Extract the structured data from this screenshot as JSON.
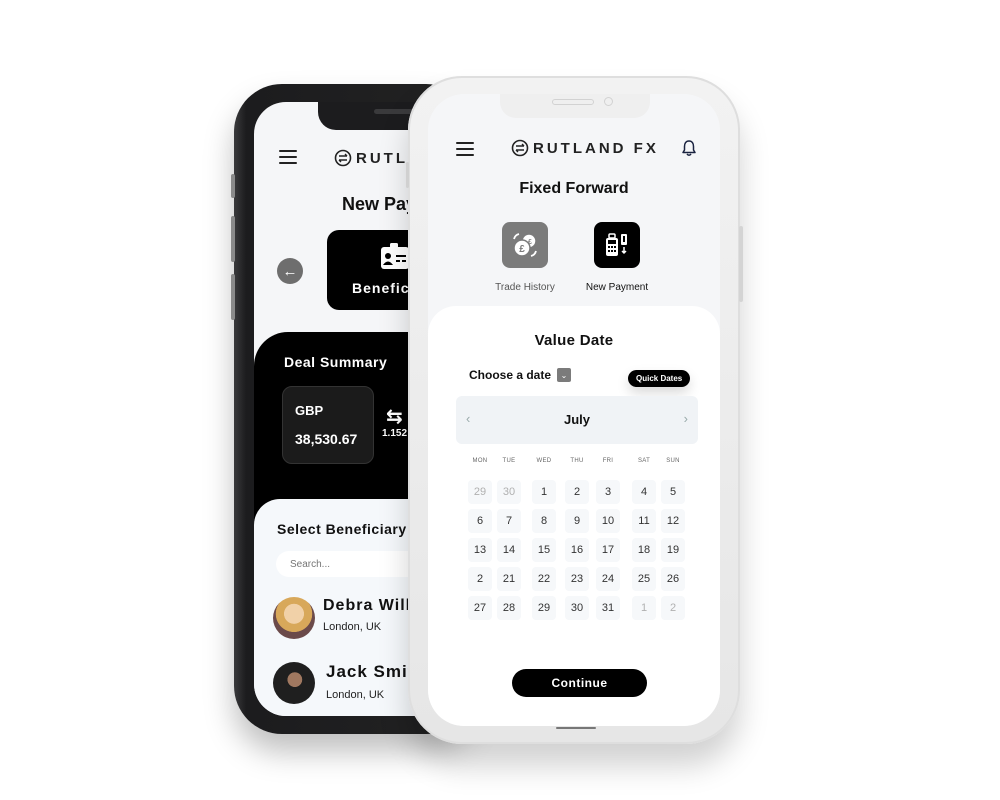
{
  "back_phone": {
    "brand": "RUTLAND FX",
    "page_title": "New Payment",
    "back_icon": "arrow-left-icon",
    "beneficiary_card": {
      "icon": "id-card-icon",
      "label": "Beneficiary"
    },
    "deal_summary": {
      "title": "Deal Summary",
      "currency": "GBP",
      "amount": "38,530.67",
      "swap_icon": "swap-arrows-icon",
      "rate": "1.152"
    },
    "select_beneficiary": {
      "title": "Select Beneficiary",
      "search_placeholder": "Search...",
      "items": [
        {
          "name": "Debra Williams",
          "location": "London, UK",
          "avatar_color": "#c9a06a"
        },
        {
          "name": "Jack Smith",
          "location": "London, UK",
          "avatar_color": "#2a2a2a"
        }
      ]
    }
  },
  "front_phone": {
    "brand": "RUTLAND FX",
    "menu_icon": "hamburger-icon",
    "bell_icon": "bell-icon",
    "page_title": "Fixed Forward",
    "tiles": [
      {
        "label": "Trade History",
        "icon": "coins-exchange-icon"
      },
      {
        "label": "New Payment",
        "icon": "card-terminal-icon"
      }
    ],
    "value_date": {
      "title": "Value Date",
      "choose_label": "Choose a date",
      "quick_dates_label": "Quick Dates",
      "month": "July",
      "weekdays": [
        "MON",
        "TUE",
        "WED",
        "THU",
        "FRI",
        "SAT",
        "SUN"
      ],
      "weeks": [
        [
          {
            "d": "29",
            "muted": true
          },
          {
            "d": "30",
            "muted": true
          },
          {
            "d": "1"
          },
          {
            "d": "2"
          },
          {
            "d": "3"
          },
          {
            "d": "4"
          },
          {
            "d": "5"
          }
        ],
        [
          {
            "d": "6"
          },
          {
            "d": "7"
          },
          {
            "d": "8"
          },
          {
            "d": "9"
          },
          {
            "d": "10"
          },
          {
            "d": "11"
          },
          {
            "d": "12"
          }
        ],
        [
          {
            "d": "13"
          },
          {
            "d": "14"
          },
          {
            "d": "15"
          },
          {
            "d": "16"
          },
          {
            "d": "17"
          },
          {
            "d": "18"
          },
          {
            "d": "19"
          }
        ],
        [
          {
            "d": "2"
          },
          {
            "d": "21"
          },
          {
            "d": "22"
          },
          {
            "d": "23"
          },
          {
            "d": "24"
          },
          {
            "d": "25"
          },
          {
            "d": "26"
          }
        ],
        [
          {
            "d": "27"
          },
          {
            "d": "28"
          },
          {
            "d": "29"
          },
          {
            "d": "30"
          },
          {
            "d": "31"
          },
          {
            "d": "1",
            "muted": true
          },
          {
            "d": "2",
            "muted": true
          }
        ]
      ],
      "continue_label": "Continue"
    }
  }
}
